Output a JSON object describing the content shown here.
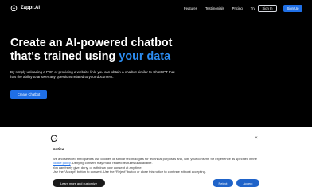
{
  "nav": {
    "brand_name": "Zappr.AI",
    "links": [
      "Features",
      "Testimonials",
      "Pricing",
      "Try"
    ],
    "sign_in": "Sign In",
    "sign_up": "Sign Up"
  },
  "hero": {
    "title_line1": "Create an AI-powered chatbot",
    "title_line2_prefix": "that's trained using ",
    "title_accent": "your data",
    "description": "By simply uploading a PDF or providing a website link, you can obtain a chatbot similar to ChatGPT that has the ability to answer any questions related to your document.",
    "cta": "Create Chatbot"
  },
  "consent": {
    "title": "Notice",
    "text_part1": "We and selected third parties use cookies or similar technologies for technical purposes and, with your consent, for experience as specified in the ",
    "link_text": "cookie policy",
    "text_part2": ". Denying consent may make related features unavailable.",
    "line2": "You can freely give, deny, or withdraw your consent at any time.",
    "line3": "Use the “Accept” button to consent. Use the “Reject” button or close this notice to continue without accepting.",
    "learn_more": "Learn more and customize",
    "reject": "Reject",
    "accept": "Accept",
    "close": "×"
  },
  "colors": {
    "background": "#000000",
    "accent": "#2c8df2",
    "primary_button": "#1f6fe6",
    "consent_button": "#1f63c9"
  },
  "icons": {
    "brand": "chat-bubble-icon",
    "consent_logo": "chat-bubble-icon",
    "close": "close-icon"
  }
}
